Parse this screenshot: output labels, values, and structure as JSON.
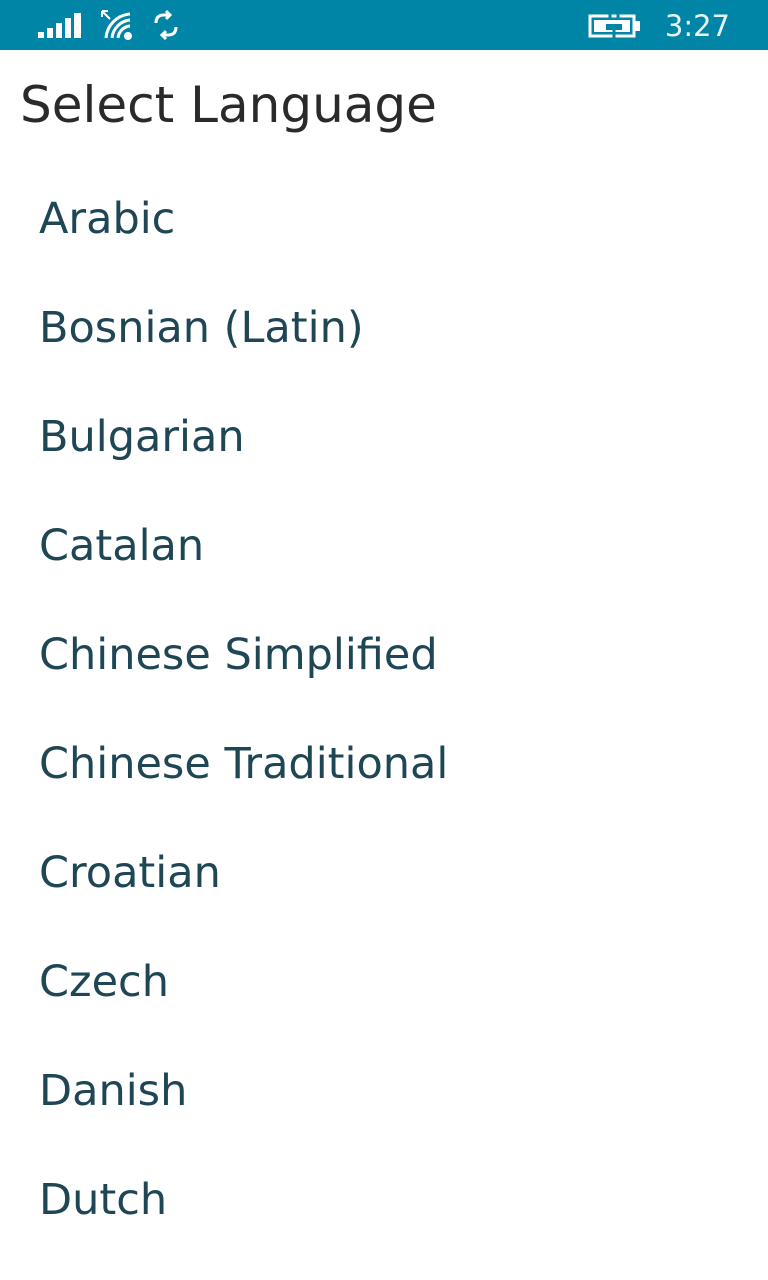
{
  "status_bar": {
    "time": "3:27",
    "icons": [
      "signal-icon",
      "wifi-icon",
      "sync-icon",
      "battery-charging-icon"
    ],
    "background_color": "#0085a6"
  },
  "page": {
    "title": "Select Language"
  },
  "languages": [
    {
      "label": "Arabic"
    },
    {
      "label": "Bosnian (Latin)"
    },
    {
      "label": "Bulgarian"
    },
    {
      "label": "Catalan"
    },
    {
      "label": "Chinese Simplified"
    },
    {
      "label": "Chinese Traditional"
    },
    {
      "label": "Croatian"
    },
    {
      "label": "Czech"
    },
    {
      "label": "Danish"
    },
    {
      "label": "Dutch"
    }
  ],
  "colors": {
    "title_text": "#2a2a2a",
    "item_text": "#1e4654"
  }
}
